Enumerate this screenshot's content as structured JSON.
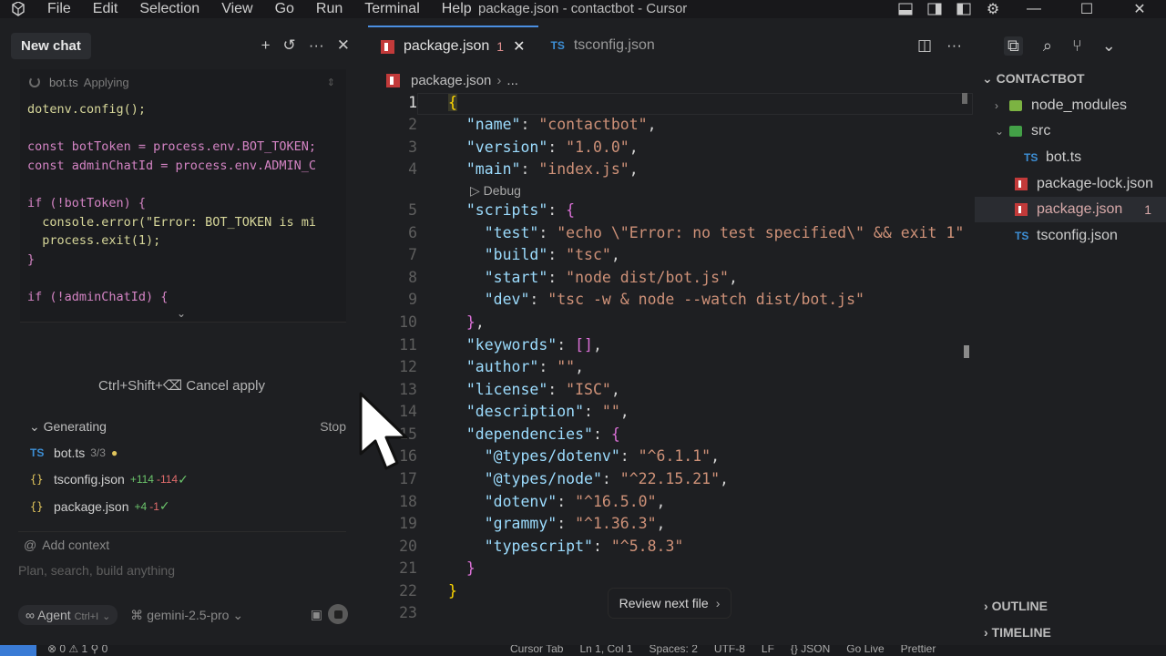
{
  "window": {
    "menu": [
      "File",
      "Edit",
      "Selection",
      "View",
      "Go",
      "Run",
      "Terminal",
      "Help"
    ],
    "title": "package.json - contactbot - Cursor"
  },
  "chat": {
    "new_chat_label": "New chat",
    "apply_file": "bot.ts",
    "apply_status": "Applying",
    "code_lines": [
      "dotenv.config();",
      "",
      "const botToken = process.env.BOT_TOKEN;",
      "const adminChatId = process.env.ADMIN_C",
      "",
      "if (!botToken) {",
      "  console.error(\"Error: BOT_TOKEN is mi",
      "  process.exit(1);",
      "}",
      "",
      "if (!adminChatId) {"
    ],
    "cancel_apply": "Ctrl+Shift+⌫ Cancel apply",
    "generating_label": "Generating",
    "stop_label": "Stop",
    "files": [
      {
        "name": "bot.ts",
        "meta": "3/3",
        "type": "ts"
      },
      {
        "name": "tsconfig.json",
        "added": "+114",
        "removed": "-114",
        "type": "json"
      },
      {
        "name": "package.json",
        "added": "+4",
        "removed": "-1",
        "type": "json"
      }
    ],
    "add_context": "Add context",
    "input_placeholder": "Plan, search, build anything",
    "mode": "Agent",
    "mode_shortcut": "Ctrl+I",
    "model": "gemini-2.5-pro"
  },
  "editor": {
    "tabs": [
      {
        "label": "package.json",
        "badge": "1",
        "active": true
      },
      {
        "label": "tsconfig.json",
        "active": false
      }
    ],
    "breadcrumb_file": "package.json",
    "breadcrumb_more": "...",
    "debug_label": "Debug",
    "review_label": "Review next file",
    "line_numbers": [
      "1",
      "2",
      "3",
      "4",
      "5",
      "6",
      "7",
      "8",
      "9",
      "10",
      "11",
      "12",
      "13",
      "14",
      "15",
      "16",
      "17",
      "18",
      "19",
      "20",
      "21",
      "22",
      "23"
    ]
  },
  "explorer": {
    "root": "CONTACTBOT",
    "items": [
      {
        "label": "node_modules",
        "kind": "folder"
      },
      {
        "label": "src",
        "kind": "folder-open"
      },
      {
        "label": "bot.ts",
        "kind": "ts"
      },
      {
        "label": "package-lock.json",
        "kind": "npm"
      },
      {
        "label": "package.json",
        "kind": "npm",
        "count": "1",
        "selected": true
      },
      {
        "label": "tsconfig.json",
        "kind": "ts"
      }
    ],
    "outline": "OUTLINE",
    "timeline": "TIMELINE"
  },
  "status": {
    "problems": "⊗ 0 ⚠ 1   ⚲ 0",
    "items": [
      "Cursor Tab",
      "Ln 1, Col 1",
      "Spaces: 2",
      "UTF-8",
      "LF",
      "{} JSON",
      "Go Live",
      "Prettier"
    ]
  },
  "colors": {
    "accent": "#4b8fe2",
    "npm_red": "#c23a3a",
    "ts_blue": "#3d8fd6"
  }
}
